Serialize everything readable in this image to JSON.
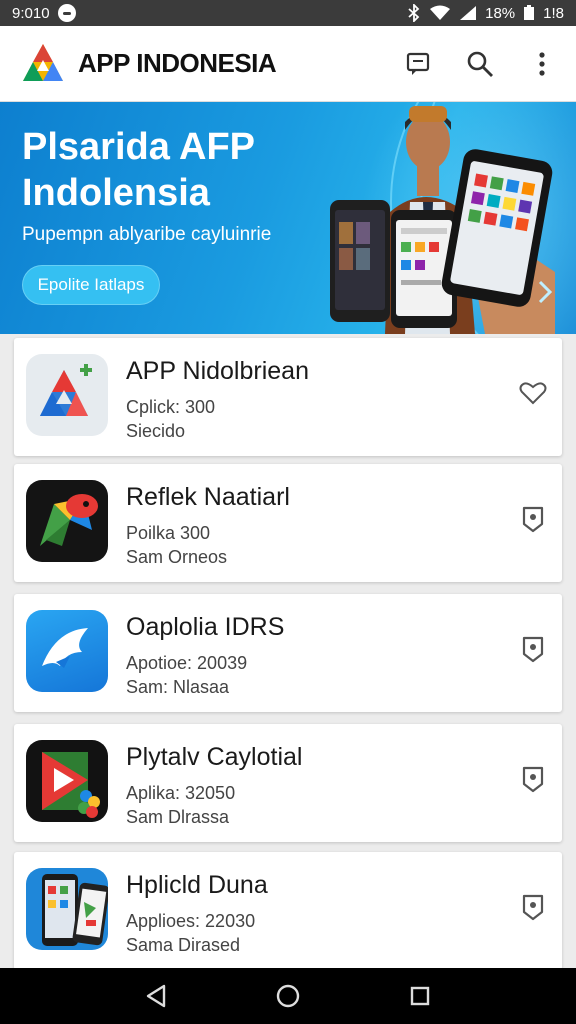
{
  "status_bar": {
    "time": "9:010",
    "battery_text": "18%",
    "clock_right": "1!8"
  },
  "app_bar": {
    "title": "APP INDONESIA",
    "icons": [
      "feedback-icon",
      "search-icon",
      "more-vert-icon"
    ]
  },
  "hero": {
    "title_line1": "Plsarida AFP",
    "title_line2": "Indolensia",
    "subtitle": "Pupempn ablyaribe cayluinrie",
    "button_label": "Epolite Iatlaps"
  },
  "apps": [
    {
      "name": "APP Nidolbriean",
      "meta": "Cplick: 300",
      "meta2": "Siecido",
      "icon": "triangle-logo-icon",
      "action_icon": "heart-outline-icon"
    },
    {
      "name": "Reflek Naatiarl",
      "meta": "Poilka 300",
      "meta2": "Sam Orneos",
      "icon": "colorful-bird-icon",
      "action_icon": "shield-badge-icon"
    },
    {
      "name": "Oaplolia IDRS",
      "meta": "Apotioe: 20039",
      "meta2": "Sam: Nlasaa",
      "icon": "blue-bird-icon",
      "action_icon": "shield-badge-icon"
    },
    {
      "name": "Plytalv Caylotial",
      "meta": "Aplika: 32050",
      "meta2": "Sam Dlrassa",
      "icon": "play-flower-icon",
      "action_icon": "shield-badge-icon"
    },
    {
      "name": "Hplicld Duna",
      "meta": "Applioes: 22030",
      "meta2": "Sama Dirased",
      "icon": "phones-icon",
      "action_icon": "shield-badge-icon"
    }
  ],
  "nav_bar": {
    "icons": [
      "back-icon",
      "home-icon",
      "recents-icon"
    ]
  }
}
